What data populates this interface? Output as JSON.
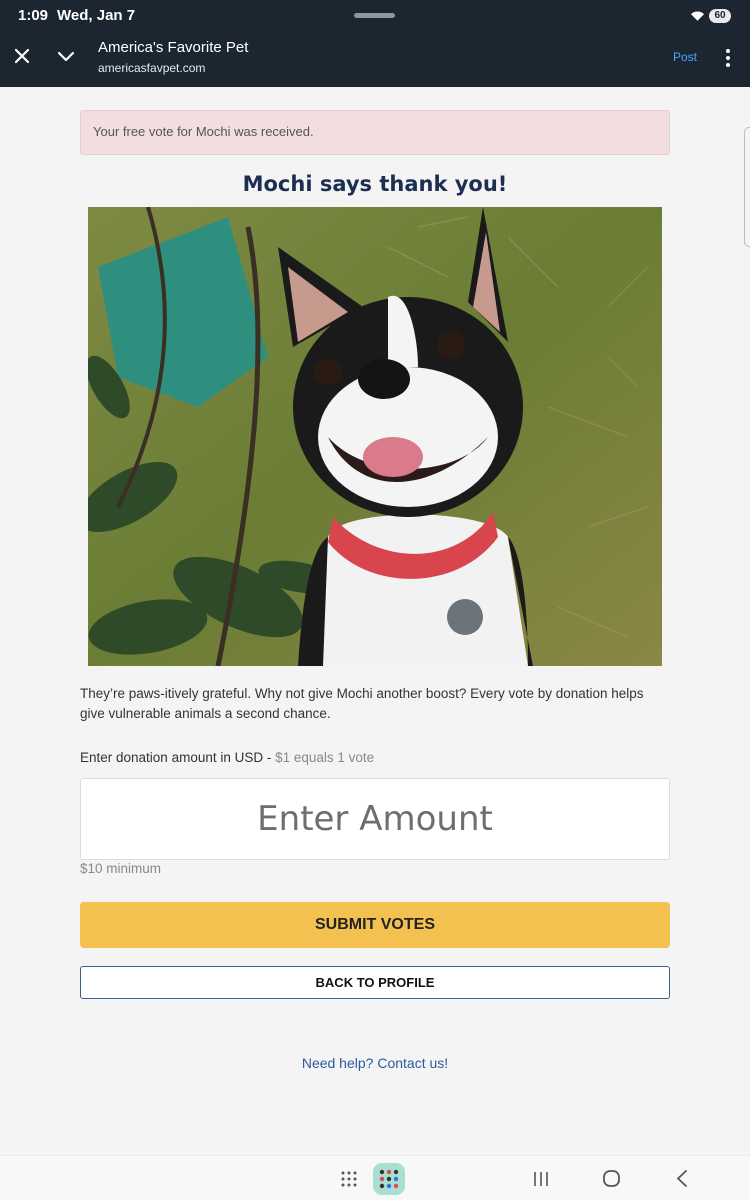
{
  "status_bar": {
    "time": "1:09",
    "date": "Wed, Jan 7",
    "battery": "60"
  },
  "browser": {
    "title": "America's Favorite Pet",
    "url": "americasfavpet.com",
    "post_label": "Post"
  },
  "alert": {
    "text": "Your free vote for Mochi was received."
  },
  "heading": "Mochi says thank you!",
  "description": "They’re paws-itively grateful. Why not give Mochi another boost? Every vote by donation helps give vulnerable animals a second chance.",
  "donation": {
    "label": "Enter donation amount in USD - ",
    "hint": "$1 equals 1 vote",
    "placeholder": "Enter Amount",
    "minimum": "$10 minimum"
  },
  "buttons": {
    "submit": "SUBMIT VOTES",
    "back": "BACK TO PROFILE"
  },
  "help_link": "Need help? Contact us!",
  "colors": {
    "top_bar": "#1b2631",
    "alert_bg": "#f2dede",
    "heading": "#1c2f53",
    "submit_bg": "#f3c14f",
    "link": "#2c5aa0"
  },
  "icons": {
    "close": "close-icon",
    "collapse": "chevron-down-icon",
    "menu": "more-vert-icon",
    "apps": "app-grid-icon",
    "recent": "recent-apps-icon",
    "home": "home-icon",
    "back": "back-icon"
  }
}
